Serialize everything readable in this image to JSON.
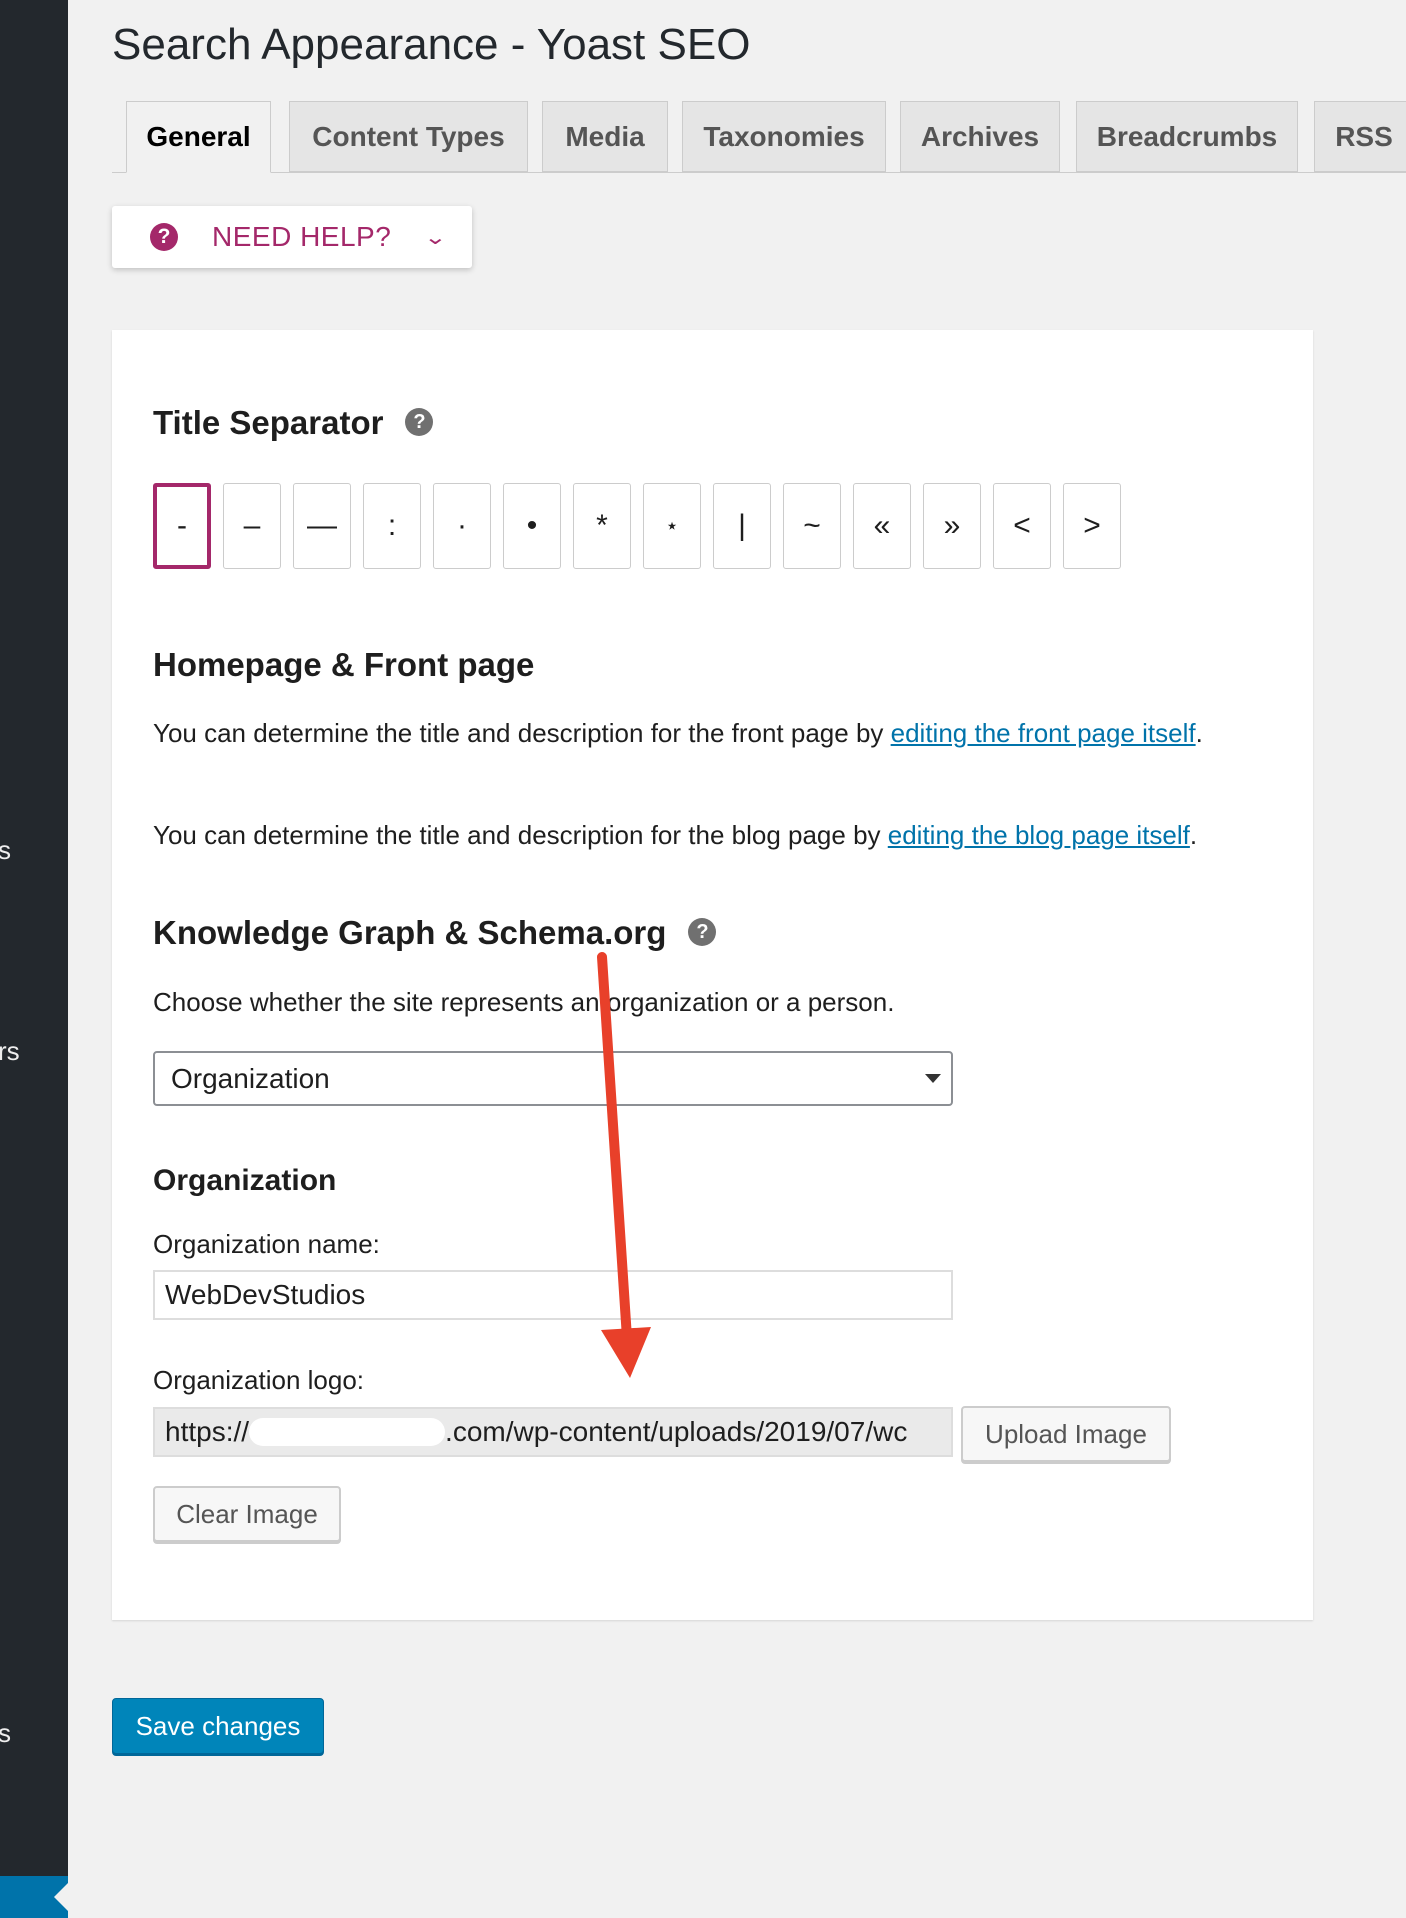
{
  "sidebar": {
    "fragments": [
      "s",
      "rs",
      "s"
    ]
  },
  "page": {
    "title": "Search Appearance - Yoast SEO"
  },
  "tabs": [
    {
      "label": "General",
      "active": true
    },
    {
      "label": "Content Types",
      "active": false
    },
    {
      "label": "Media",
      "active": false
    },
    {
      "label": "Taxonomies",
      "active": false
    },
    {
      "label": "Archives",
      "active": false
    },
    {
      "label": "Breadcrumbs",
      "active": false
    },
    {
      "label": "RSS",
      "active": false
    }
  ],
  "help": {
    "label": "NEED HELP?",
    "icon": "question-circle-icon"
  },
  "title_separator": {
    "heading": "Title Separator",
    "options": [
      "-",
      "–",
      "—",
      ":",
      "·",
      "•",
      "*",
      "⋆",
      "|",
      "~",
      "«",
      "»",
      "<",
      ">"
    ],
    "selected": "-"
  },
  "homepage": {
    "heading": "Homepage & Front page",
    "front_text": "You can determine the title and description for the front page by ",
    "front_link": "editing the front page itself",
    "blog_text": "You can determine the title and description for the blog page by ",
    "blog_link": "editing the blog page itself",
    "period": "."
  },
  "knowledge_graph": {
    "heading": "Knowledge Graph & Schema.org",
    "description": "Choose whether the site represents an organization or a person.",
    "selected": "Organization"
  },
  "organization": {
    "heading": "Organization",
    "name_label": "Organization name:",
    "name_value": "WebDevStudios",
    "logo_label": "Organization logo:",
    "logo_prefix": "https://",
    "logo_suffix": ".com/wp-content/uploads/2019/07/wc",
    "upload_label": "Upload Image",
    "clear_label": "Clear Image"
  },
  "save_label": "Save changes",
  "colors": {
    "accent": "#a4286a",
    "link": "#0073aa",
    "primary_button": "#0085ba",
    "sidebar": "#23282d",
    "annotation_arrow": "#e8402a"
  }
}
